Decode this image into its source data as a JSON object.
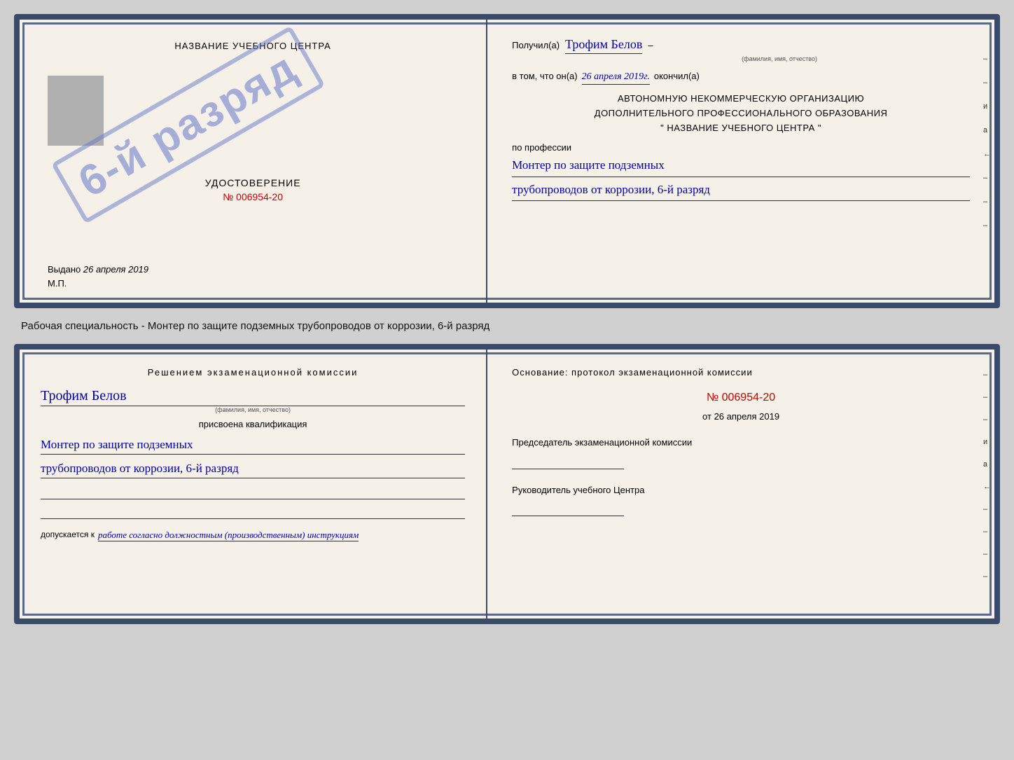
{
  "top_doc": {
    "left": {
      "center_title": "НАЗВАНИЕ УЧЕБНОГО ЦЕНТРА",
      "stamp_text": "6-й разряд",
      "udostoverenie_label": "УДОСТОВЕРЕНИЕ",
      "udostoverenie_number": "№ 006954-20",
      "vydano_label": "Выдано",
      "vydano_date": "26 апреля 2019",
      "mp_label": "М.П."
    },
    "right": {
      "poluchil_label": "Получил(а)",
      "poluchil_name": "Трофим Белов",
      "fio_small": "(фамилия, имя, отчество)",
      "vtom_label": "в том, что он(а)",
      "date_value": "26 апреля 2019г.",
      "okonchil_label": "окончил(а)",
      "org_line1": "АВТОНОМНУЮ НЕКОММЕРЧЕСКУЮ ОРГАНИЗАЦИЮ",
      "org_line2": "ДОПОЛНИТЕЛЬНОГО ПРОФЕССИОНАЛЬНОГО ОБРАЗОВАНИЯ",
      "org_line3": "\"  НАЗВАНИЕ УЧЕБНОГО ЦЕНТРА  \"",
      "po_professii": "по профессии",
      "profession_line1": "Монтер по защите подземных",
      "profession_line2": "трубопроводов от коррозии, 6-й разряд",
      "side_chars": [
        "–",
        "–",
        "и",
        "а",
        "←",
        "–",
        "–",
        "–"
      ]
    }
  },
  "middle_text": "Рабочая специальность - Монтер по защите подземных трубопроводов от коррозии, 6-й разряд",
  "bottom_doc": {
    "left": {
      "resheniyem_title": "Решением экзаменационной комиссии",
      "name": "Трофим Белов",
      "fio_small": "(фамилия, имя, отчество)",
      "prisvoena": "присвоена квалификация",
      "kvalifikaciya_line1": "Монтер по защите подземных",
      "kvalifikaciya_line2": "трубопроводов от коррозии, 6-й разряд",
      "dopuskaetsya_label": "допускается к",
      "dopuskaetsya_value": "работе согласно должностным (производственным) инструкциям"
    },
    "right": {
      "osnovanie_title": "Основание: протокол экзаменационной комиссии",
      "protocol_number": "№ 006954-20",
      "ot_label": "от",
      "ot_date": "26 апреля 2019",
      "predsedatel_label": "Председатель экзаменационной комиссии",
      "rukovoditel_label": "Руководитель учебного Центра",
      "side_chars": [
        "–",
        "–",
        "–",
        "и",
        "а",
        "←",
        "–",
        "–",
        "–",
        "–"
      ]
    }
  }
}
